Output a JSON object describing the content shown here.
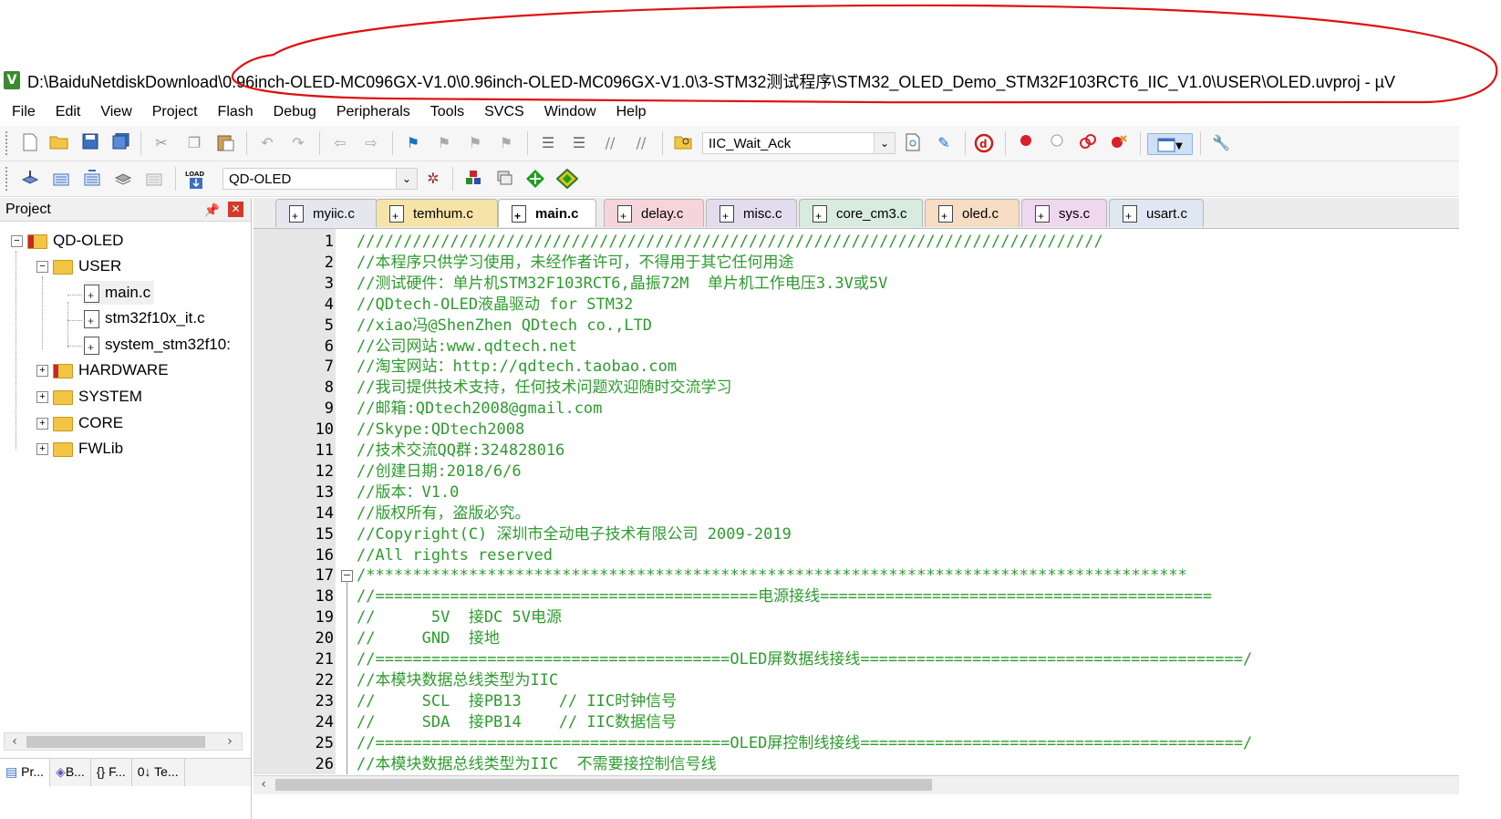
{
  "window": {
    "title": "D:\\BaiduNetdiskDownload\\0.96inch-OLED-MC096GX-V1.0\\0.96inch-OLED-MC096GX-V1.0\\3-STM32测试程序\\STM32_OLED_Demo_STM32F103RCT6_IIC_V1.0\\USER\\OLED.uvproj - µV",
    "app_icon": "keil-uvision-icon",
    "annotation_color": "#e01010"
  },
  "menu": [
    "File",
    "Edit",
    "View",
    "Project",
    "Flash",
    "Debug",
    "Peripherals",
    "Tools",
    "SVCS",
    "Window",
    "Help"
  ],
  "toolbar1": {
    "find_combo_value": "IIC_Wait_Ack"
  },
  "toolbar2": {
    "load_label": "LOAD",
    "target_combo_value": "QD-OLED"
  },
  "project_panel": {
    "title": "Project",
    "tree": {
      "root": "QD-OLED",
      "user_group": "USER",
      "user_files": [
        "main.c",
        "stm32f10x_it.c",
        "system_stm32f10:"
      ],
      "groups": [
        "HARDWARE",
        "SYSTEM",
        "CORE",
        "FWLib"
      ]
    },
    "bottom_tabs": [
      "Pr...",
      "B...",
      "{} F...",
      "0↓ Te..."
    ]
  },
  "tabs": [
    "myiic.c",
    "temhum.c",
    "main.c",
    "delay.c",
    "misc.c",
    "core_cm3.c",
    "oled.c",
    "sys.c",
    "usart.c"
  ],
  "tab_colors": [
    "#e6e6ef",
    "#f6e3a8",
    "#ffffff",
    "#f6d4dc",
    "#e3dcef",
    "#d7ebdf",
    "#f7dcc4",
    "#efd7ef",
    "#dfe7f3"
  ],
  "active_tab": "main.c",
  "code_color": "#2e9b2e",
  "code_lines": [
    {
      "n": "1",
      "text": "////////////////////////////////////////////////////////////////////////////////"
    },
    {
      "n": "2",
      "text": "//本程序只供学习使用，未经作者许可，不得用于其它任何用途"
    },
    {
      "n": "3",
      "text": "//测试硬件：单片机STM32F103RCT6,晶振72M  单片机工作电压3.3V或5V"
    },
    {
      "n": "4",
      "text": "//QDtech-OLED液晶驱动 for STM32"
    },
    {
      "n": "5",
      "text": "//xiao冯@ShenZhen QDtech co.,LTD"
    },
    {
      "n": "6",
      "text": "//公司网站:www.qdtech.net"
    },
    {
      "n": "7",
      "text": "//淘宝网站：http://qdtech.taobao.com"
    },
    {
      "n": "8",
      "text": "//我司提供技术支持，任何技术问题欢迎随时交流学习"
    },
    {
      "n": "9",
      "text": "//邮箱:QDtech2008@gmail.com"
    },
    {
      "n": "10",
      "text": "//Skype:QDtech2008"
    },
    {
      "n": "11",
      "text": "//技术交流QQ群:324828016"
    },
    {
      "n": "12",
      "text": "//创建日期:2018/6/6"
    },
    {
      "n": "13",
      "text": "//版本：V1.0"
    },
    {
      "n": "14",
      "text": "//版权所有，盗版必究。"
    },
    {
      "n": "15",
      "text": "//Copyright(C) 深圳市全动电子技术有限公司 2009-2019"
    },
    {
      "n": "16",
      "text": "//All rights reserved"
    },
    {
      "n": "17",
      "text": "/****************************************************************************************"
    },
    {
      "n": "18",
      "text": "//=========================================电源接线=========================================="
    },
    {
      "n": "19",
      "text": "//      5V  接DC 5V电源"
    },
    {
      "n": "20",
      "text": "//     GND  接地"
    },
    {
      "n": "21",
      "text": "//======================================OLED屏数据线接线=========================================/"
    },
    {
      "n": "22",
      "text": "//本模块数据总线类型为IIC"
    },
    {
      "n": "23",
      "text": "//     SCL  接PB13    // IIC时钟信号"
    },
    {
      "n": "24",
      "text": "//     SDA  接PB14    // IIC数据信号"
    },
    {
      "n": "25",
      "text": "//======================================OLED屏控制线接线=========================================/"
    },
    {
      "n": "26",
      "text": "//本模块数据总线类型为IIC  不需要接控制信号线"
    }
  ]
}
